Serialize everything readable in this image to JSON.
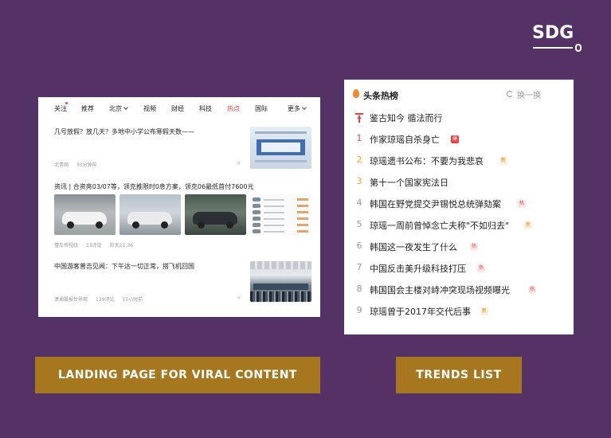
{
  "logo": {
    "text": "SDG"
  },
  "landing": {
    "nav": [
      {
        "label": "关注",
        "active": false
      },
      {
        "label": "推荐",
        "active": false
      },
      {
        "label": "北京",
        "active": false,
        "dropdown": true
      },
      {
        "label": "视频",
        "active": false
      },
      {
        "label": "财经",
        "active": false
      },
      {
        "label": "科技",
        "active": false
      },
      {
        "label": "热点",
        "active": true
      },
      {
        "label": "国际",
        "active": false
      },
      {
        "label": "更多",
        "active": false,
        "dropdown": true
      }
    ],
    "articles": [
      {
        "title": "几号放假？放几天？多地中小学公布寒假天数——",
        "meta": [
          "北青网",
          "30分钟前"
        ]
      },
      {
        "title": "资讯 | 合资亮03/07等，领克推限时0息方案，领克06最低首付7600元",
        "meta": [
          "懂车帝视线",
          "13评论",
          "前天21:36"
        ]
      },
      {
        "title": "中国游客普吉见闻：下午达一切正常，搭飞机回国",
        "meta": [
          "潇湘晨报世界观",
          "129评论",
          "15小时前"
        ]
      }
    ]
  },
  "trends": {
    "title": "头条热榜",
    "refresh_label": "换一换",
    "items": [
      {
        "rank": "",
        "title": "鉴古知今 循法而行",
        "badge": "",
        "pinned": true
      },
      {
        "rank": "1",
        "title": "作家琼瑶自杀身亡",
        "badge": "爆",
        "badge_type": "boil"
      },
      {
        "rank": "2",
        "title": "琼瑶遗书公布：不要为我悲哀",
        "badge": "新",
        "badge_type": "new"
      },
      {
        "rank": "3",
        "title": "第十一个国家宪法日",
        "badge": "",
        "badge_type": ""
      },
      {
        "rank": "4",
        "title": "韩国在野党提交尹锡悦总统弹劾案",
        "badge": "热",
        "badge_type": "hot"
      },
      {
        "rank": "5",
        "title": "琼瑶一周前曾悼念亡夫称\"不如归去\"",
        "badge": "新",
        "badge_type": "new"
      },
      {
        "rank": "6",
        "title": "韩国这一夜发生了什么",
        "badge": "热",
        "badge_type": "hot"
      },
      {
        "rank": "7",
        "title": "中国反击美升级科技打压",
        "badge": "热",
        "badge_type": "hot"
      },
      {
        "rank": "8",
        "title": "韩国国会主楼对峙冲突现场视频曝光",
        "badge": "热",
        "badge_type": "hot"
      },
      {
        "rank": "9",
        "title": "琼瑶曾于2017年交代后事",
        "badge": "新",
        "badge_type": "new"
      }
    ],
    "rank_colors": {
      "1": "#f04142",
      "2": "#f5a623",
      "3": "#f5a623"
    }
  },
  "captions": {
    "landing": "LANDING PAGE FOR VIRAL CONTENT",
    "trends": "TRENDS LIST"
  }
}
